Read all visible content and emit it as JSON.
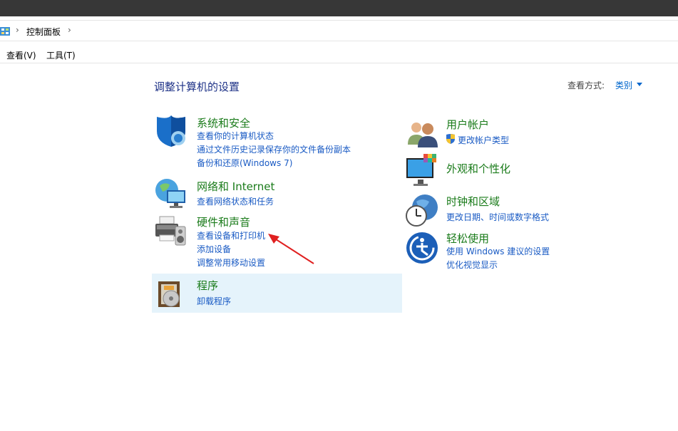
{
  "breadcrumb": {
    "root": "控制面板"
  },
  "menu": {
    "view": "查看(V)",
    "tools": "工具(T)"
  },
  "header": {
    "title": "调整计算机的设置",
    "view_by_label": "查看方式:",
    "view_by_value": "类别"
  },
  "categories": {
    "system_security": {
      "title": "系统和安全",
      "links": [
        "查看你的计算机状态",
        "通过文件历史记录保存你的文件备份副本",
        "备份和还原(Windows 7)"
      ]
    },
    "network": {
      "title": "网络和 Internet",
      "links": [
        "查看网络状态和任务"
      ]
    },
    "hardware": {
      "title": "硬件和声音",
      "links": [
        "查看设备和打印机",
        "添加设备",
        "调整常用移动设置"
      ]
    },
    "programs": {
      "title": "程序",
      "links": [
        "卸载程序"
      ]
    },
    "user_accounts": {
      "title": "用户帐户",
      "links": [
        "更改帐户类型"
      ]
    },
    "appearance": {
      "title": "外观和个性化",
      "links": []
    },
    "clock_region": {
      "title": "时钟和区域",
      "links": [
        "更改日期、时间或数字格式"
      ]
    },
    "ease_access": {
      "title": "轻松使用",
      "links": [
        "使用 Windows 建议的设置",
        "优化视觉显示"
      ]
    }
  },
  "colors": {
    "title_green": "#1a7b1a",
    "link_blue": "#1a5bc4",
    "highlight": "#e5f3fb",
    "annotation_arrow": "#e02020"
  }
}
